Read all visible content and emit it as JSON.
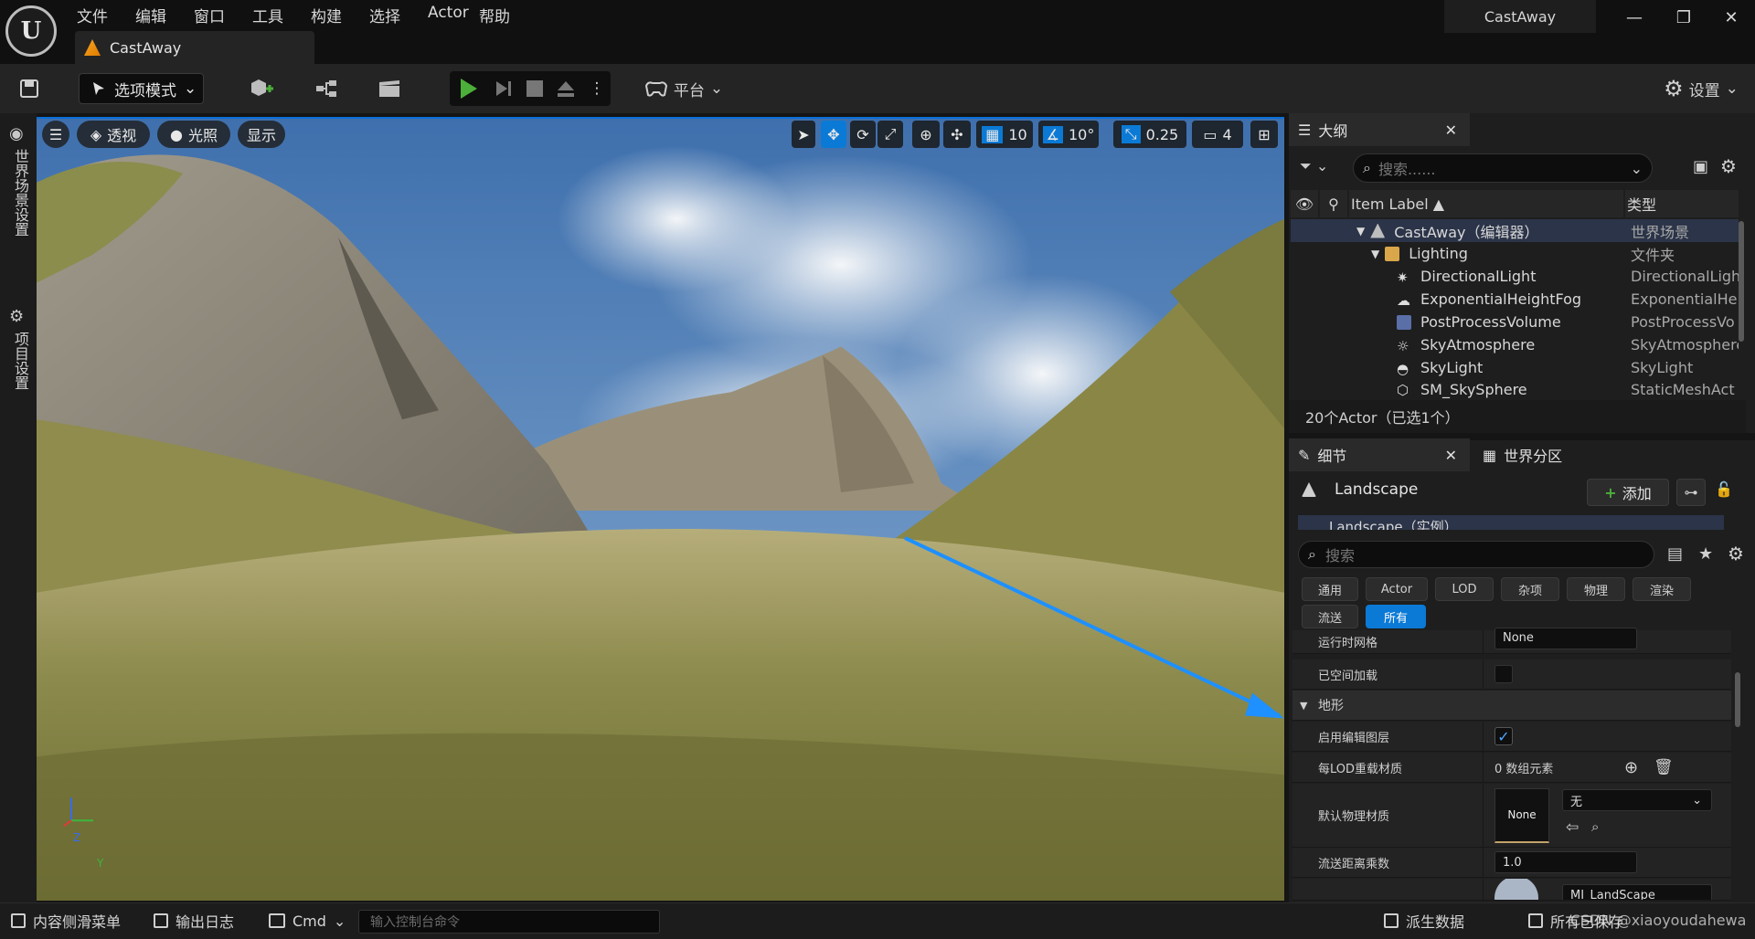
{
  "app": {
    "logo_text": "U",
    "menu": [
      "文件",
      "编辑",
      "窗口",
      "工具",
      "构建",
      "选择",
      "Actor",
      "帮助"
    ],
    "document_tab": "CastAway",
    "project_title": "CastAway",
    "window_controls": {
      "minimize": "—",
      "restore": "❐",
      "close": "✕"
    }
  },
  "toolbar": {
    "mode_label": "选项模式",
    "platform_label": "平台",
    "settings_label": "设置"
  },
  "left_strip": {
    "world_settings": "世界场景设置",
    "project_settings": "项目设置"
  },
  "viewport": {
    "perspective": "透视",
    "lighting": "光照",
    "show": "显示",
    "grid_snap": "10",
    "rotation_snap": "10°",
    "scale_snap": "0.25",
    "camera_speed": "4",
    "axis_z": "Z",
    "axis_y": "Y"
  },
  "outliner": {
    "tab": "大纲",
    "search_placeholder": "搜索......",
    "col_label": "Item Label ▲",
    "col_type": "类型",
    "rows": [
      {
        "label": "CastAway（编辑器）",
        "type": "世界场景"
      },
      {
        "label": "Lighting",
        "type": "文件夹"
      },
      {
        "label": "DirectionalLight",
        "type": "DirectionalLight"
      },
      {
        "label": "ExponentialHeightFog",
        "type": "ExponentialHe"
      },
      {
        "label": "PostProcessVolume",
        "type": "PostProcessVo"
      },
      {
        "label": "SkyAtmosphere",
        "type": "SkyAtmosphere"
      },
      {
        "label": "SkyLight",
        "type": "SkyLight"
      },
      {
        "label": "SM_SkySphere",
        "type": "StaticMeshAct"
      }
    ],
    "status": "20个Actor（已选1个）"
  },
  "details": {
    "tab": "细节",
    "tab2": "世界分区",
    "object_name": "Landscape",
    "add_label": "添加",
    "instance_label": "Landscape（实例）",
    "search_placeholder": "搜索",
    "filters": [
      "通用",
      "Actor",
      "LOD",
      "杂项",
      "物理",
      "渲染",
      "流送",
      "所有"
    ],
    "props": {
      "runtime_grid": {
        "label": "运行时网格",
        "value": "None"
      },
      "spatially_loaded": {
        "label": "已空间加载"
      },
      "section_terrain": "地形",
      "edit_layers": {
        "label": "启用编辑图层"
      },
      "lod_material": {
        "label": "每LOD重载材质",
        "value": "0 数组元素"
      },
      "phys_material": {
        "label": "默认物理材质",
        "thumb": "None",
        "value": "无"
      },
      "stream_dist": {
        "label": "流送距离乘数",
        "value": "1.0"
      },
      "partial_material": "MI_LandScape"
    }
  },
  "statusbar": {
    "content_drawer": "内容侧滑菜单",
    "output_log": "输出日志",
    "cmd": "Cmd",
    "console_placeholder": "输入控制台命令",
    "derived_data": "派生数据",
    "saved": "所有已保存",
    "watermark": "CSDN @xiaoyoudahewa"
  },
  "colors": {
    "accent": "#0b7ad6",
    "play": "#4caf3a",
    "annotation_arrow": "#1e90ff"
  }
}
